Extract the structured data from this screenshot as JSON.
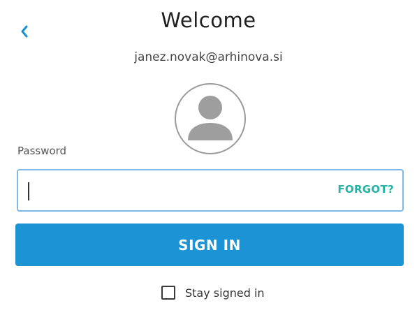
{
  "header": {
    "back_icon": "chevron-left-icon",
    "title": "Welcome",
    "email": "janez.novak@arhinova.si"
  },
  "avatar": {
    "icon": "user-silhouette-icon"
  },
  "password": {
    "label": "Password",
    "value": "",
    "placeholder": "",
    "forgot_label": "FORGOT?"
  },
  "actions": {
    "sign_in_label": "SIGN IN"
  },
  "stay_signed_in": {
    "label": "Stay signed in",
    "checked": false
  },
  "colors": {
    "accent": "#1c93d4",
    "forgot_link": "#27b3a4",
    "field_focus_border": "#7fb8e2",
    "back_chevron": "#1c8fd0",
    "avatar_gray": "#9e9e9e"
  }
}
